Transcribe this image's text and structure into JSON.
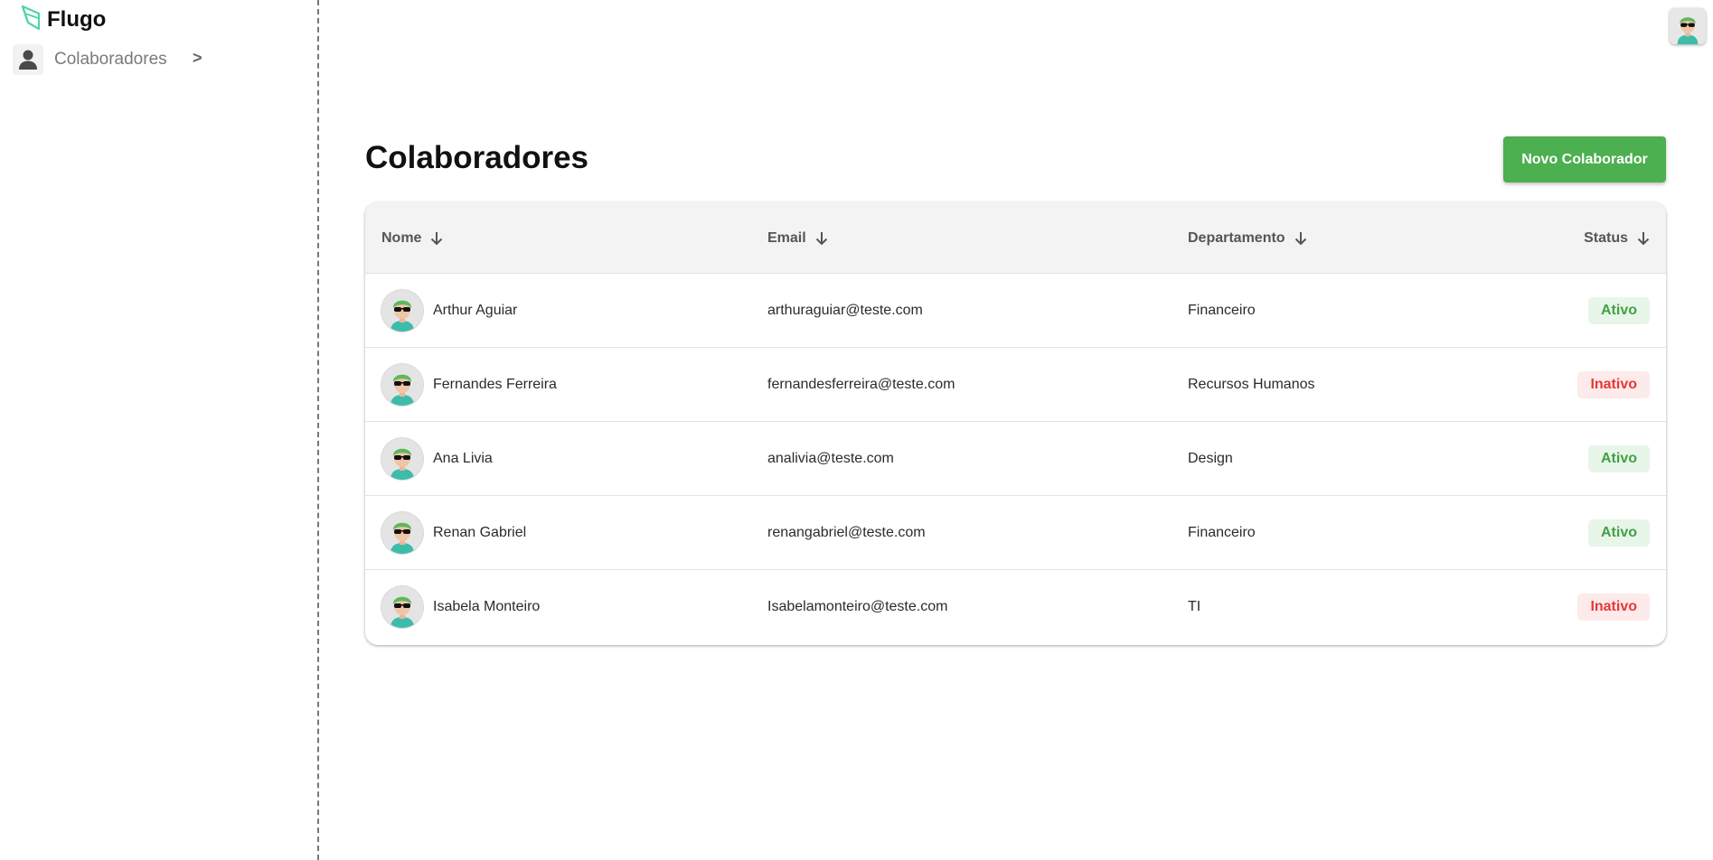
{
  "app": {
    "brand": "Flugo"
  },
  "sidebar": {
    "items": [
      {
        "label": "Colaboradores",
        "chevron": ">"
      }
    ]
  },
  "main": {
    "title": "Colaboradores",
    "new_button": "Novo Colaborador",
    "columns": {
      "nome": "Nome",
      "email": "Email",
      "departamento": "Departamento",
      "status": "Status"
    },
    "rows": [
      {
        "nome": "Arthur Aguiar",
        "email": "arthuraguiar@teste.com",
        "departamento": "Financeiro",
        "status": "Ativo"
      },
      {
        "nome": "Fernandes Ferreira",
        "email": "fernandesferreira@teste.com",
        "departamento": "Recursos Humanos",
        "status": "Inativo"
      },
      {
        "nome": "Ana Livia",
        "email": "analivia@teste.com",
        "departamento": "Design",
        "status": "Ativo"
      },
      {
        "nome": "Renan Gabriel",
        "email": "renangabriel@teste.com",
        "departamento": "Financeiro",
        "status": "Ativo"
      },
      {
        "nome": "Isabela Monteiro",
        "email": "Isabelamonteiro@teste.com",
        "departamento": "TI",
        "status": "Inativo"
      }
    ]
  },
  "colors": {
    "primary": "#4caf50",
    "active_text": "#43a047",
    "active_bg": "#e8f5e9",
    "inactive_text": "#e53935",
    "inactive_bg": "#fdeaea",
    "logo": "#4fd6a4"
  },
  "icons": {
    "logo": "leaf-logo-icon",
    "nav": "person-icon",
    "sort": "arrow-down-icon",
    "avatar": "avatar-icon"
  }
}
